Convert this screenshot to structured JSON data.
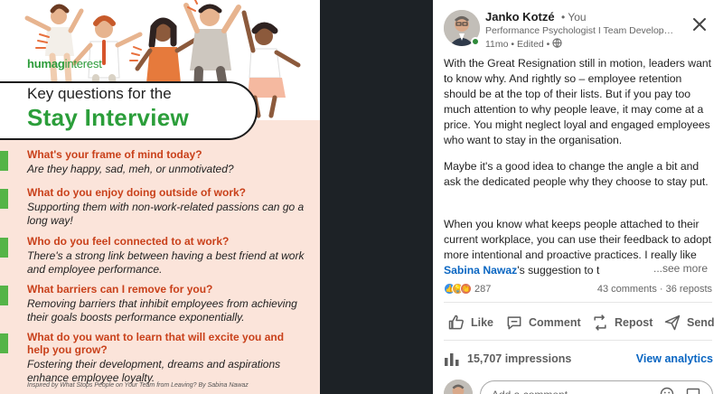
{
  "infographic": {
    "logo_bold": "humag",
    "logo_thin": "interest",
    "title_line1": "Key questions for the",
    "title_line2": "Stay Interview",
    "questions": [
      {
        "heading": "What's your frame of mind today?",
        "body": "Are they happy, sad, meh, or unmotivated?"
      },
      {
        "heading": "What do you enjoy doing outside of work?",
        "body": "Supporting them with non-work-related passions can go a long way!"
      },
      {
        "heading": "Who do you feel connected to at work?",
        "body": "There's a strong link between having a best friend at work and employee performance."
      },
      {
        "heading": "What barriers can I remove for you?",
        "body": "Removing barriers that inhibit employees from achieving their goals boosts performance exponentially."
      },
      {
        "heading_line1": "What do you want to learn that will excite you and",
        "heading_line2": "help you grow?",
        "body": "Fostering their development, dreams and aspirations enhance employee loyalty."
      }
    ],
    "credit": "Inspired by What Stops People on Your Team from Leaving? By Sabina Nawaz",
    "colors": {
      "green": "#2b9e3a",
      "orange": "#c9411b",
      "peach": "#fbe4da"
    }
  },
  "post": {
    "author_name": "Janko Kotzé",
    "author_badge": "• You",
    "author_title": "Performance Psychologist I Team Development",
    "meta": "11mo • Edited •",
    "paragraph1": "With the Great Resignation still in motion, leaders want to know why. And rightly so – employee retention should be at the top of their lists. But if you pay too much attention to why people leave, it may come at a price. You might neglect loyal and engaged employees who want to stay in the organisation.",
    "paragraph2": "Maybe it's a good idea to change the angle a bit and ask the dedicated people why they choose to stay put.",
    "paragraph3_before": "When you know what keeps people attached to their current workplace, you can use their feedback to adopt more intentional and proactive practices. I really like ",
    "paragraph3_mention": "Sabina Nawaz",
    "paragraph3_after": "'s suggestion to t",
    "see_more": "...see more",
    "reaction_count": "287",
    "comments_reposts": "43 comments · 36 reposts",
    "actions": {
      "like": "Like",
      "comment": "Comment",
      "repost": "Repost",
      "send": "Send"
    },
    "impressions": "15,707 impressions",
    "analytics": "View analytics",
    "comment_placeholder": "Add a comment…",
    "colors": {
      "link": "#0a66c2",
      "online": "#2f8a3a"
    }
  }
}
